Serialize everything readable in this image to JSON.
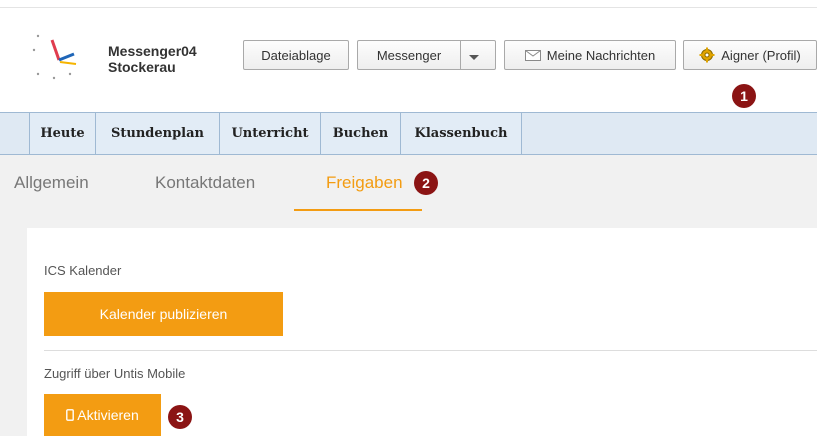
{
  "header": {
    "school_line1": "Messenger04",
    "school_line2": "Stockerau",
    "buttons": {
      "dateiablage": "Dateiablage",
      "messenger": "Messenger",
      "nachrichten": "Meine Nachrichten",
      "profil": "Aigner (Profil)"
    }
  },
  "nav": {
    "items": [
      "Heute",
      "Stundenplan",
      "Unterricht",
      "Buchen",
      "Klassenbuch"
    ]
  },
  "tabs": [
    "Allgemein",
    "Kontaktdaten",
    "Freigaben"
  ],
  "active_tab": "Freigaben",
  "sections": {
    "ics": {
      "label": "ICS Kalender",
      "button": "Kalender publizieren"
    },
    "mobile": {
      "label": "Zugriff über Untis Mobile",
      "button": "Aktivieren"
    }
  },
  "badges": [
    "1",
    "2",
    "3"
  ],
  "colors": {
    "accent": "#f39c12",
    "badge": "#8b1414",
    "nav_bg": "#dfe9f3"
  },
  "icons": {
    "nachrichten": "envelope-icon",
    "profil": "gear-icon",
    "aktivieren": "mobile-phone-icon",
    "messenger_dropdown": "caret-down-icon"
  }
}
